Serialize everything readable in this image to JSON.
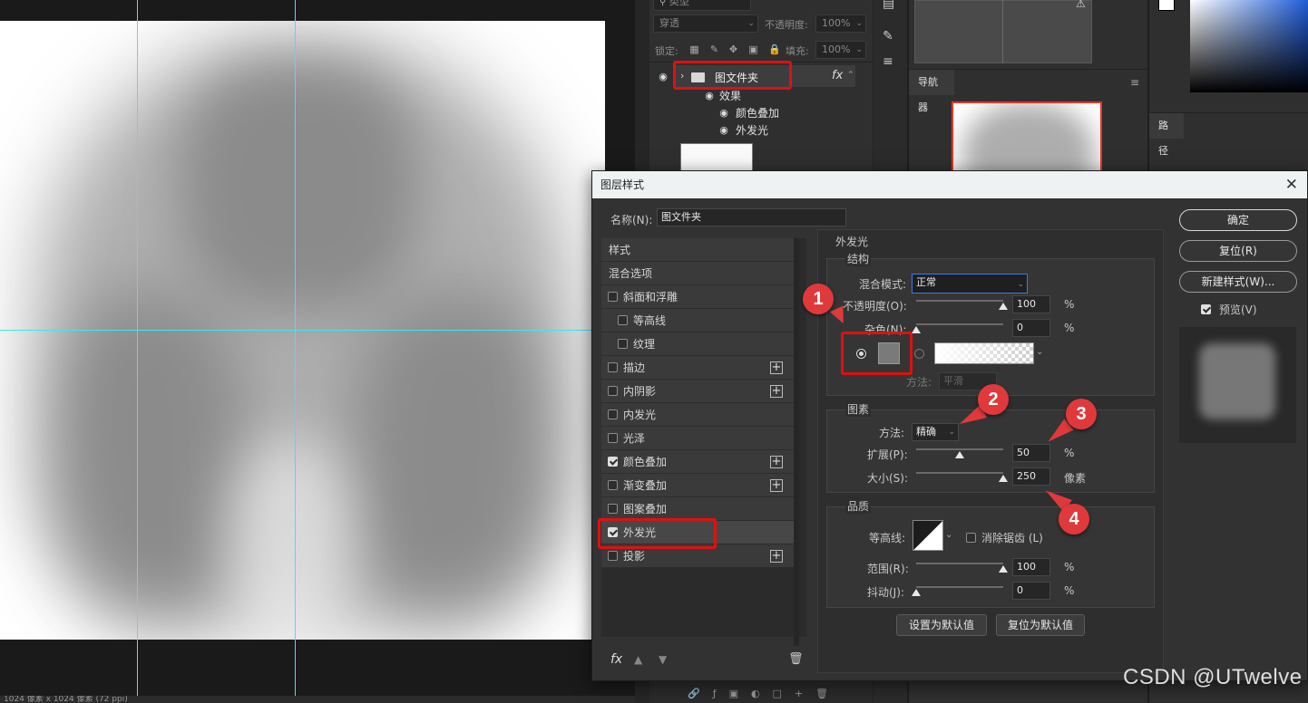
{
  "layers_panel": {
    "kind_filter": "类型",
    "blend_mode": "穿透",
    "opacity_label": "不透明度:",
    "opacity_value": "100%",
    "lock_label": "锁定:",
    "fill_label": "填充:",
    "fill_value": "100%",
    "folder_name": "图文件夹",
    "fx_label": "fx",
    "effects_label": "效果",
    "effect_items": [
      "颜色叠加",
      "外发光"
    ]
  },
  "navigator": {
    "tab_label": "导航器"
  },
  "paths_panel": {
    "tab_label": "路径"
  },
  "status_bar": {
    "text": "1024 像素 x 1024 像素 (72 ppi)"
  },
  "dialog": {
    "title": "图层样式",
    "name_label": "名称(N):",
    "name_value": "图文件夹",
    "styles_header": "样式",
    "blend_options": "混合选项",
    "styles": [
      {
        "label": "斜面和浮雕",
        "checked": false,
        "plus": false
      },
      {
        "label": "等高线",
        "checked": false,
        "plus": false
      },
      {
        "label": "纹理",
        "checked": false,
        "plus": false
      },
      {
        "label": "描边",
        "checked": false,
        "plus": true
      },
      {
        "label": "内阴影",
        "checked": false,
        "plus": true
      },
      {
        "label": "内发光",
        "checked": false,
        "plus": false
      },
      {
        "label": "光泽",
        "checked": false,
        "plus": false
      },
      {
        "label": "颜色叠加",
        "checked": true,
        "plus": true
      },
      {
        "label": "渐变叠加",
        "checked": false,
        "plus": true
      },
      {
        "label": "图案叠加",
        "checked": false,
        "plus": false
      },
      {
        "label": "外发光",
        "checked": true,
        "plus": false
      },
      {
        "label": "投影",
        "checked": false,
        "plus": true
      }
    ],
    "footer_fx": "fx",
    "outer_glow": {
      "section_title": "外发光",
      "structure_title": "结构",
      "blend_mode_label": "混合模式:",
      "blend_mode_value": "正常",
      "opacity_label": "不透明度(O):",
      "opacity_value": "100",
      "opacity_level": 100,
      "noise_label": "杂色(N):",
      "noise_value": "0",
      "noise_level": 0,
      "pct": "%",
      "glow_color": "#7a7a7a",
      "method_label_dim": "方法:",
      "method_value_dim": "平滑",
      "elements_title": "图素",
      "technique_label": "方法:",
      "technique_value": "精确",
      "spread_label": "扩展(P):",
      "spread_value": "50",
      "spread_level": 50,
      "size_label": "大小(S):",
      "size_value": "250",
      "size_level": 100,
      "size_unit": "像素",
      "quality_title": "品质",
      "contour_label": "等高线:",
      "anti_alias_label": "消除锯齿 (L)",
      "range_label": "范围(R):",
      "range_value": "100",
      "range_level": 100,
      "jitter_label": "抖动(J):",
      "jitter_value": "0",
      "jitter_level": 0,
      "set_default": "设置为默认值",
      "reset_default": "复位为默认值"
    },
    "buttons": {
      "ok": "确定",
      "reset": "复位(R)",
      "new_style": "新建样式(W)...",
      "preview": "预览(V)"
    }
  },
  "annotations": [
    "1",
    "2",
    "3",
    "4"
  ],
  "watermark": "CSDN @UTwelve",
  "colors": {
    "annotation_red": "#e0393c",
    "highlight_red": "#e01010",
    "guide_cyan": "#3ee6f0"
  }
}
